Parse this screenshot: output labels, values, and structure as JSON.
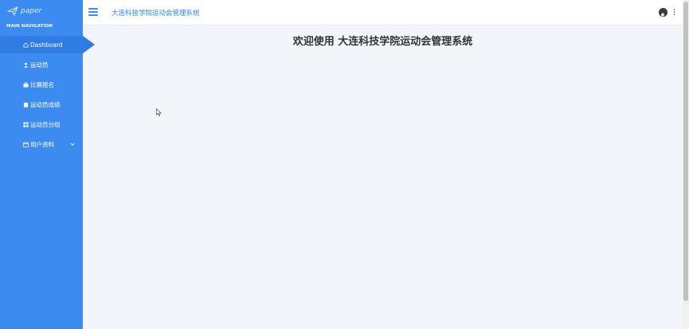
{
  "sidebar": {
    "logo_text": "paper",
    "nav_header": "MAIN NAVIGATION",
    "items": [
      {
        "label": "Dashboard",
        "icon": "home-icon"
      },
      {
        "label": "运动员",
        "icon": "user-icon"
      },
      {
        "label": "比赛报名",
        "icon": "suitcase-icon"
      },
      {
        "label": "运动员成绩",
        "icon": "document-icon"
      },
      {
        "label": "运动员分组",
        "icon": "grid-icon"
      },
      {
        "label": "用户资料",
        "icon": "calendar-icon"
      }
    ]
  },
  "topbar": {
    "title": "大连科技学院运动会管理系统"
  },
  "main": {
    "welcome": "欢迎使用 大连科技学院运动会管理系统"
  },
  "colors": {
    "sidebar_bg": "#3b8bf0",
    "active_bg": "#2f7ce3",
    "title_blue": "#2f86e8",
    "page_bg": "#f2f5f9"
  }
}
